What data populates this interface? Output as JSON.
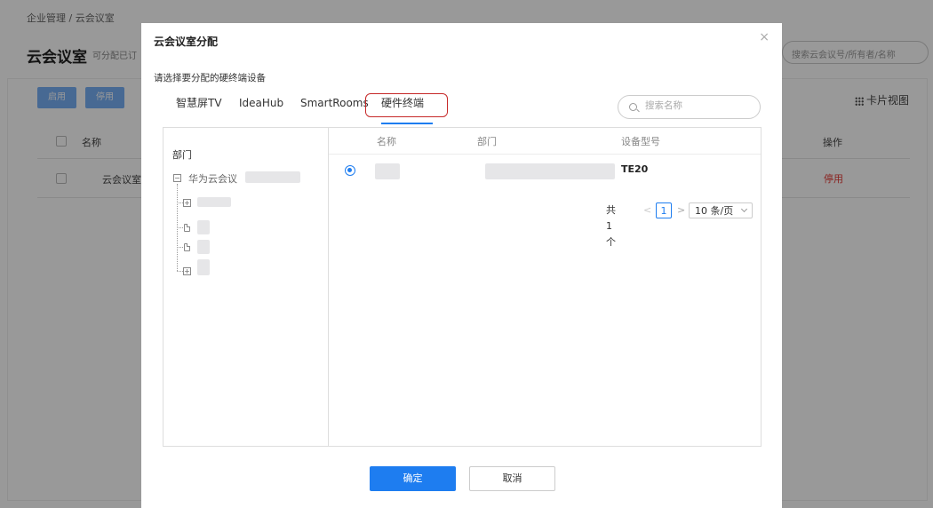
{
  "background": {
    "breadcrumb": "企业管理 / 云会议室",
    "title": "云会议室",
    "subtitle": "可分配已订",
    "search_placeholder": "搜索云会议号/所有者/名称",
    "enable_button": "启用",
    "disable_button": "停用",
    "card_view": "卡片视图",
    "columns": {
      "name": "名称",
      "action": "操作"
    },
    "row": {
      "name": "云会议室",
      "action": "停用"
    }
  },
  "modal": {
    "title": "云会议室分配",
    "close_icon": "×",
    "hint": "请选择要分配的硬终端设备",
    "tabs": [
      {
        "label": "智慧屏TV"
      },
      {
        "label": "IdeaHub"
      },
      {
        "label": "SmartRooms"
      },
      {
        "label": "硬件终端",
        "active": true
      }
    ],
    "search_placeholder": "搜索名称",
    "dept_header": "部门",
    "tree_root": "华为云会议",
    "table": {
      "headers": {
        "name": "名称",
        "dept": "部门",
        "model": "设备型号"
      },
      "rows": [
        {
          "model": "TE20",
          "selected": true
        }
      ]
    },
    "pagination": {
      "total": "共1个",
      "prev": "<",
      "current": "1",
      "next": ">",
      "page_size": "10 条/页"
    },
    "ok_button": "确定",
    "cancel_button": "取消"
  },
  "colors": {
    "primary": "#1e7df0",
    "highlight": "#c62828",
    "danger": "#e53935"
  }
}
